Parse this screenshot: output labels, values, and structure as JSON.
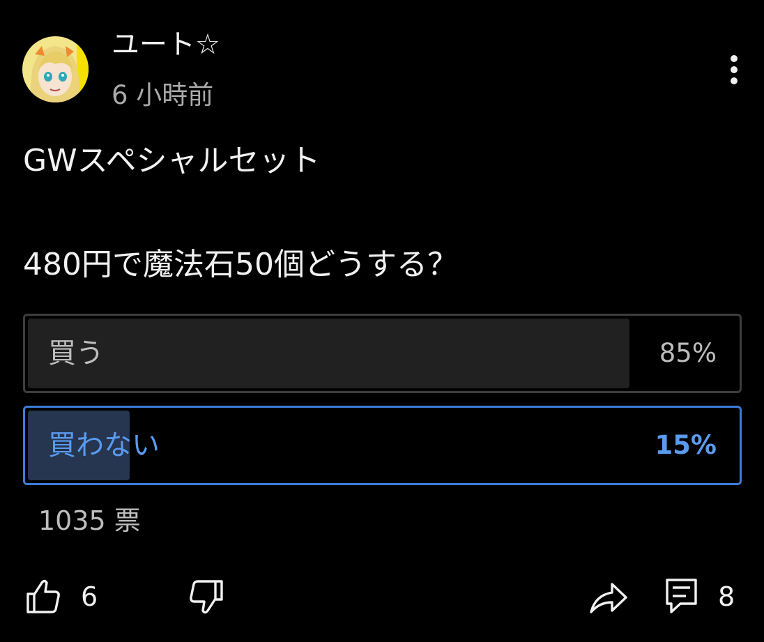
{
  "post": {
    "author": "ユート☆",
    "time": "6 小時前",
    "lines": [
      "GWスペシャルセット",
      "480円で魔法石50個どうする？"
    ]
  },
  "poll": {
    "options": [
      {
        "label": "買う",
        "percent_text": "85%",
        "percent": 85,
        "selected": false
      },
      {
        "label": "買わない",
        "percent_text": "15%",
        "percent": 15,
        "selected": true
      }
    ],
    "votes": "1035 票"
  },
  "actions": {
    "like_count": "6",
    "comment_count": "8"
  },
  "icons": {
    "avatar": "avatar-image",
    "menu": "more-vertical-icon",
    "like": "thumbs-up-icon",
    "dislike": "thumbs-down-icon",
    "share": "share-icon",
    "comment": "comment-icon"
  },
  "colors": {
    "background": "#000000",
    "accent": "#3e7bd6",
    "accent_text": "#5a9bf0",
    "bar_fill": "#212121",
    "bar_fill_selected": "#263550",
    "muted_text": "#aaaaaa"
  }
}
